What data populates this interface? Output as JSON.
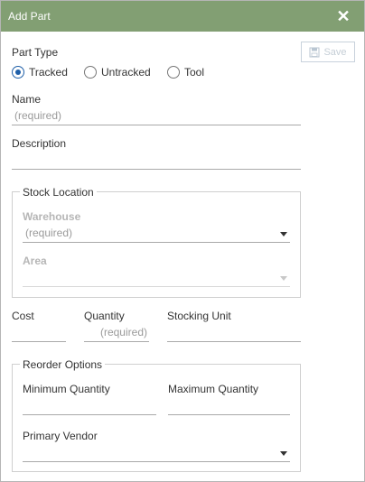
{
  "dialog": {
    "title": "Add Part",
    "close_icon": "close-icon",
    "save_label": "Save",
    "save_icon": "floppy-disk-icon"
  },
  "part_type": {
    "label": "Part Type",
    "options": [
      {
        "label": "Tracked",
        "checked": true
      },
      {
        "label": "Untracked",
        "checked": false
      },
      {
        "label": "Tool",
        "checked": false
      }
    ]
  },
  "name": {
    "label": "Name",
    "placeholder": "(required)"
  },
  "description": {
    "label": "Description",
    "placeholder": ""
  },
  "stock_location": {
    "legend": "Stock Location",
    "warehouse": {
      "label": "Warehouse",
      "placeholder": "(required)"
    },
    "area": {
      "label": "Area",
      "placeholder": ""
    }
  },
  "cost": {
    "label": "Cost",
    "value": ""
  },
  "quantity": {
    "label": "Quantity",
    "placeholder": "(required)"
  },
  "stocking_unit": {
    "label": "Stocking Unit",
    "value": ""
  },
  "reorder": {
    "legend": "Reorder Options",
    "min_qty": {
      "label": "Minimum Quantity",
      "value": ""
    },
    "max_qty": {
      "label": "Maximum Quantity",
      "value": ""
    },
    "primary_vendor": {
      "label": "Primary Vendor",
      "value": ""
    }
  },
  "colors": {
    "titlebar": "#829f73",
    "radio_selected": "#1f5fa8"
  }
}
